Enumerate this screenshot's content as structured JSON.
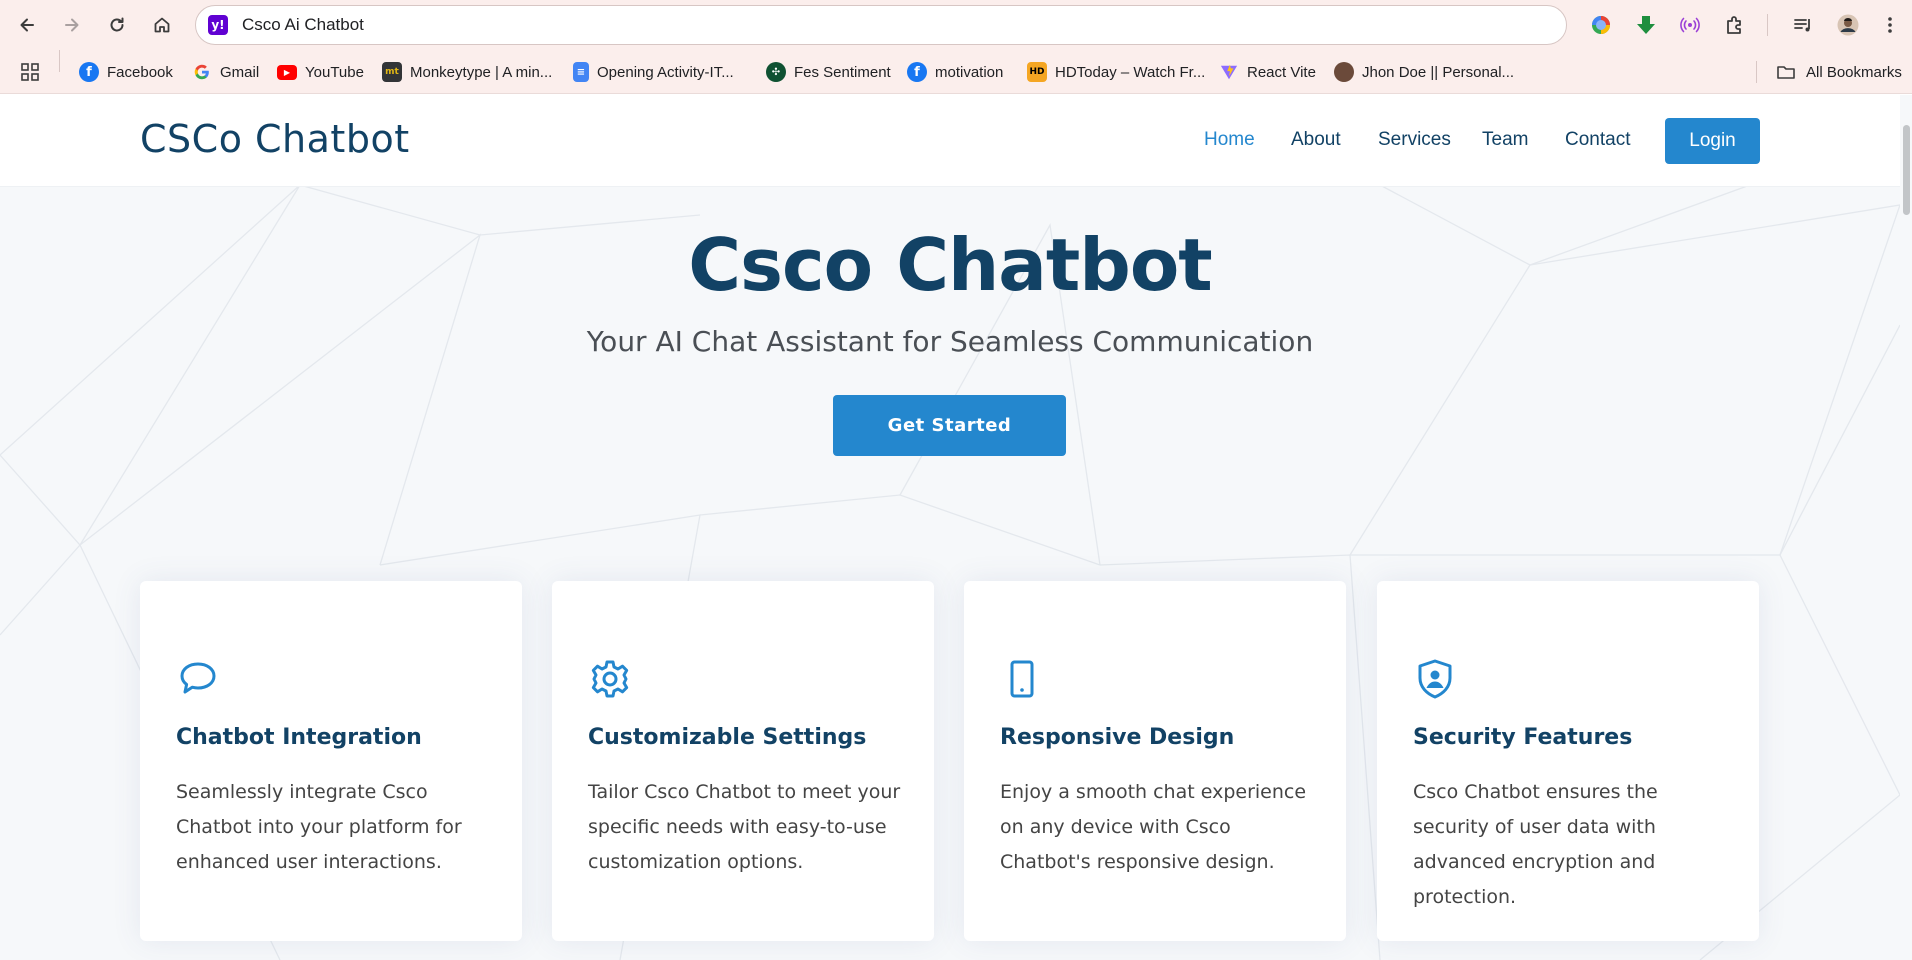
{
  "browser": {
    "address_text": "Csco Ai Chatbot",
    "bookmarks": [
      {
        "label": "Facebook",
        "icon": "facebook-icon"
      },
      {
        "label": "Gmail",
        "icon": "google-icon"
      },
      {
        "label": "YouTube",
        "icon": "youtube-icon"
      },
      {
        "label": "Monkeytype | A min...",
        "icon": "monkeytype-icon"
      },
      {
        "label": "Opening Activity-IT...",
        "icon": "google-docs-icon"
      },
      {
        "label": "Fes Sentiment",
        "icon": "sentiment-icon"
      },
      {
        "label": "motivation",
        "icon": "facebook-icon"
      },
      {
        "label": "HDToday – Watch Fr...",
        "icon": "hdtoday-icon"
      },
      {
        "label": "React Vite",
        "icon": "vite-icon"
      },
      {
        "label": "Jhon Doe || Personal...",
        "icon": "avatar-icon"
      }
    ],
    "all_bookmarks_label": "All Bookmarks"
  },
  "site": {
    "logo": "CSCo Chatbot",
    "nav": [
      "Home",
      "About",
      "Services",
      "Team",
      "Contact"
    ],
    "active_nav": "Home",
    "login_label": "Login"
  },
  "hero": {
    "title": "Csco Chatbot",
    "subtitle": "Your AI Chat Assistant for Seamless Communication",
    "cta_label": "Get Started"
  },
  "features": [
    {
      "icon": "chat-bubble-icon",
      "title": "Chatbot Integration",
      "text": "Seamlessly integrate Csco Chatbot into your platform for enhanced user interactions."
    },
    {
      "icon": "gear-icon",
      "title": "Customizable Settings",
      "text": "Tailor Csco Chatbot to meet your specific needs with easy-to-use customization options."
    },
    {
      "icon": "phone-icon",
      "title": "Responsive Design",
      "text": "Enjoy a smooth chat experience on any device with Csco Chatbot's responsive design."
    },
    {
      "icon": "shield-user-icon",
      "title": "Security Features",
      "text": "Csco Chatbot ensures the security of user data with advanced encryption and protection."
    }
  ],
  "colors": {
    "accent": "#2487ce",
    "heading": "#124265",
    "chrome_bg": "#fbeeec"
  }
}
